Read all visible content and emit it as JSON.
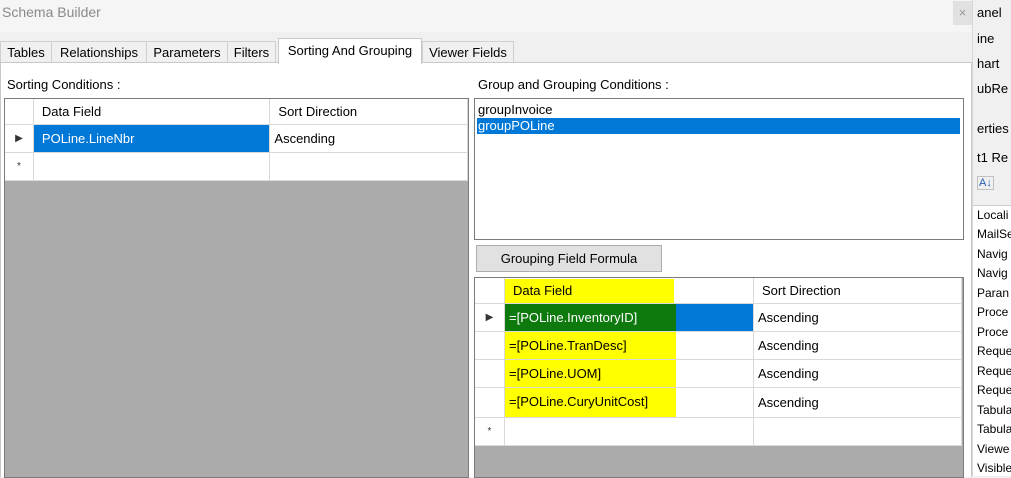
{
  "window": {
    "title": "Schema Builder",
    "close_glyph": "×"
  },
  "tabs": [
    {
      "label": "Tables"
    },
    {
      "label": "Relationships"
    },
    {
      "label": "Parameters"
    },
    {
      "label": "Filters"
    },
    {
      "label": "Sorting And Grouping"
    },
    {
      "label": "Viewer Fields"
    }
  ],
  "sorting": {
    "label": "Sorting Conditions :",
    "headers": [
      "Data Field",
      "Sort Direction"
    ],
    "rows": [
      {
        "field": "POLine.LineNbr",
        "direction": "Ascending"
      }
    ],
    "new_row_marker": "*",
    "current_row_marker": "▶"
  },
  "grouping": {
    "label": "Group and Grouping Conditions :",
    "groups": [
      "groupInvoice",
      "groupPOLine"
    ],
    "selected_group": "groupPOLine",
    "formula_button": "Grouping Field Formula",
    "headers": [
      "Data Field",
      "Sort Direction"
    ],
    "rows": [
      {
        "field": "=[POLine.InventoryID]",
        "direction": "Ascending"
      },
      {
        "field": "=[POLine.TranDesc]",
        "direction": "Ascending"
      },
      {
        "field": "=[POLine.UOM]",
        "direction": "Ascending"
      },
      {
        "field": "=[POLine.CuryUnitCost]",
        "direction": "Ascending"
      }
    ],
    "new_row_marker": "*",
    "current_row_marker": "▶"
  },
  "right_panel": {
    "top_items": [
      "anel",
      "ine",
      "hart",
      "ubRe"
    ],
    "properties_label": "erties",
    "object_label": "t1 Re",
    "sort_icon_glyph": "A↓",
    "property_items": [
      "Locali",
      "MailSe",
      "Navig",
      "Navig",
      "Paran",
      "Proce",
      "Proce",
      "Reque",
      "Reque",
      "Reque",
      "Tabula",
      "Tabula",
      "Viewe",
      "Visible"
    ]
  },
  "colors": {
    "selection": "#0078d7",
    "highlight": "#ffff00",
    "highlight_current": "#0e7a0e",
    "grid_background": "#ababab"
  }
}
